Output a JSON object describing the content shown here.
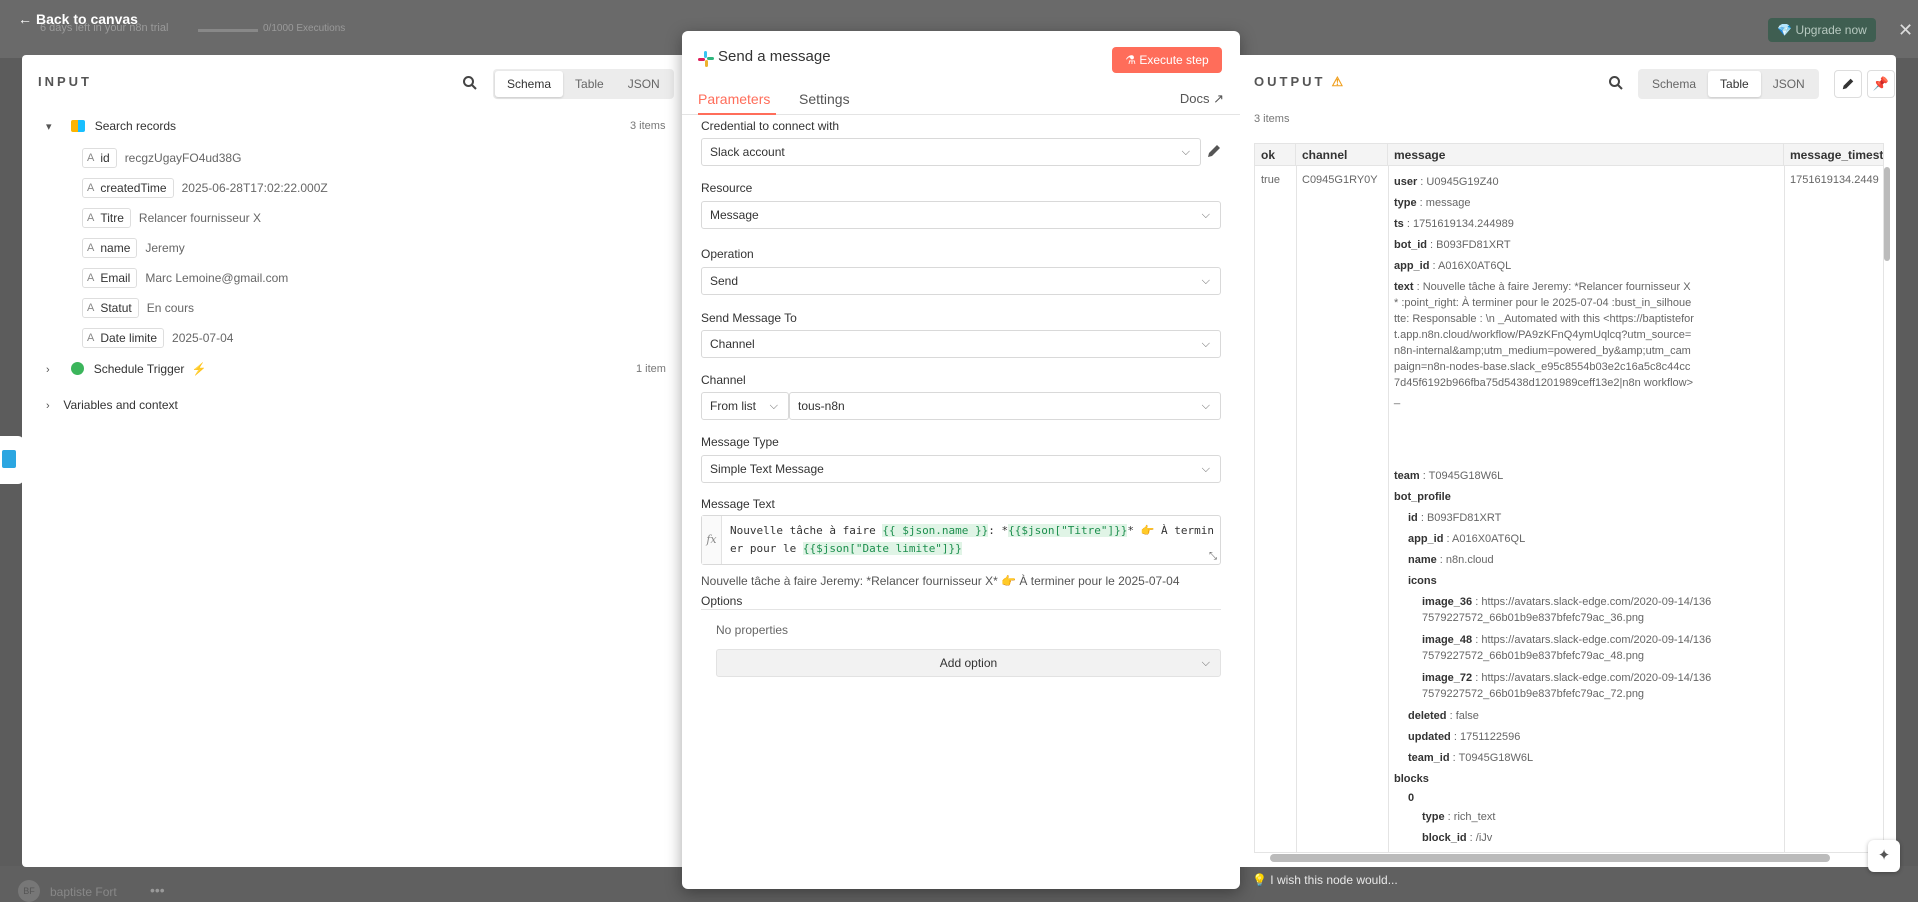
{
  "background": {
    "trial_text": "6 days left in your n8n trial",
    "executions": "0/1000 Executions",
    "upgrade_label": "Upgrade now",
    "user_name": "baptiste Fort",
    "user_initials": "BF"
  },
  "back_label": "Back to canvas",
  "input": {
    "title": "INPUT",
    "tabs": [
      "Schema",
      "Table",
      "JSON"
    ],
    "active_tab": "Schema",
    "search_records": {
      "label": "Search records",
      "count": "3 items",
      "fields": [
        {
          "name": "id",
          "value": "recgzUgayFO4ud38G"
        },
        {
          "name": "createdTime",
          "value": "2025-06-28T17:02:22.000Z"
        },
        {
          "name": "Titre",
          "value": "Relancer fournisseur X"
        },
        {
          "name": "name",
          "value": "Jeremy"
        },
        {
          "name": "Email",
          "value": "Marc Lemoine@gmail.com"
        },
        {
          "name": "Statut",
          "value": "En cours"
        },
        {
          "name": "Date limite",
          "value": "2025-07-04"
        }
      ]
    },
    "schedule_trigger": {
      "label": "Schedule Trigger",
      "count": "1 item"
    },
    "variables_label": "Variables and context"
  },
  "node": {
    "title": "Send a message",
    "execute_label": "Execute step",
    "tabs": {
      "parameters": "Parameters",
      "settings": "Settings",
      "docs": "Docs"
    },
    "credential_label": "Credential to connect with",
    "credential_value": "Slack account",
    "resource_label": "Resource",
    "resource_value": "Message",
    "operation_label": "Operation",
    "operation_value": "Send",
    "send_to_label": "Send Message To",
    "send_to_value": "Channel",
    "channel_label": "Channel",
    "channel_mode": "From list",
    "channel_value": "tous-n8n",
    "message_type_label": "Message Type",
    "message_type_value": "Simple Text Message",
    "message_text_label": "Message Text",
    "expr": {
      "p1": "Nouvelle tâche à faire ",
      "e1": "{{ $json.name }}",
      "p2": ": *",
      "e2": "{{$json[\"Titre\"]}}",
      "p3": "* 👉 À terminer pour le ",
      "e3": "{{$json[\"Date limite\"]}}"
    },
    "preview": "Nouvelle tâche à faire Jeremy: *Relancer fournisseur X* 👉 À terminer pour le 2025-07-04",
    "options_label": "Options",
    "no_properties": "No properties",
    "add_option": "Add option"
  },
  "output": {
    "title": "OUTPUT",
    "tabs": [
      "Schema",
      "Table",
      "JSON"
    ],
    "active_tab": "Table",
    "items_count": "3 items",
    "columns": [
      "ok",
      "channel",
      "message",
      "message_timest"
    ],
    "row": {
      "ok": "true",
      "channel": "C0945G1RY0Y",
      "message_ts": "1751619134.2449",
      "message": [
        {
          "k": "user",
          "v": "U0945G19Z40"
        },
        {
          "k": "type",
          "v": "message"
        },
        {
          "k": "ts",
          "v": "1751619134.244989"
        },
        {
          "k": "bot_id",
          "v": "B093FD81XRT"
        },
        {
          "k": "app_id",
          "v": "A016X0AT6QL"
        },
        {
          "k": "text",
          "v": "Nouvelle tâche à faire Jeremy: *Relancer fournisseur X* :point_right: À terminer pour le 2025-07-04 :bust_in_silhouette: Responsable : \\n _Automated with this <https://baptistefort.app.n8n.cloud/workflow/PA9zKFnQ4ymUqlcq?utm_source=n8n-internal&amp;utm_medium=powered_by&amp;utm_campaign=n8n-nodes-base.slack_e95c8554b03e2c16a5c8c44cc7d45f6192b966fba75d5438d1201989ceff13e2|n8n workflow>_"
        },
        {
          "k": "team",
          "v": "T0945G18W6L"
        }
      ],
      "bot_profile_label": "bot_profile",
      "bot_profile": [
        {
          "k": "id",
          "v": "B093FD81XRT"
        },
        {
          "k": "app_id",
          "v": "A016X0AT6QL"
        },
        {
          "k": "name",
          "v": "n8n.cloud"
        }
      ],
      "icons_label": "icons",
      "icons": [
        {
          "k": "image_36",
          "v": "https://avatars.slack-edge.com/2020-09-14/1367579227572_66b01b9e837bfefc79ac_36.png"
        },
        {
          "k": "image_48",
          "v": "https://avatars.slack-edge.com/2020-09-14/1367579227572_66b01b9e837bfefc79ac_48.png"
        },
        {
          "k": "image_72",
          "v": "https://avatars.slack-edge.com/2020-09-14/1367579227572_66b01b9e837bfefc79ac_72.png"
        }
      ],
      "bot_profile_tail": [
        {
          "k": "deleted",
          "v": "false"
        },
        {
          "k": "updated",
          "v": "1751122596"
        },
        {
          "k": "team_id",
          "v": "T0945G18W6L"
        }
      ],
      "blocks_label": "blocks",
      "blocks_index": "0",
      "blocks": [
        {
          "k": "type",
          "v": "rich_text"
        },
        {
          "k": "block_id",
          "v": "/iJv"
        }
      ]
    }
  },
  "wish_text": "I wish this node would...",
  "colors": {
    "accent": "#ff6d5a",
    "warning": "#f0a020",
    "expression": "#1d8f4e"
  }
}
